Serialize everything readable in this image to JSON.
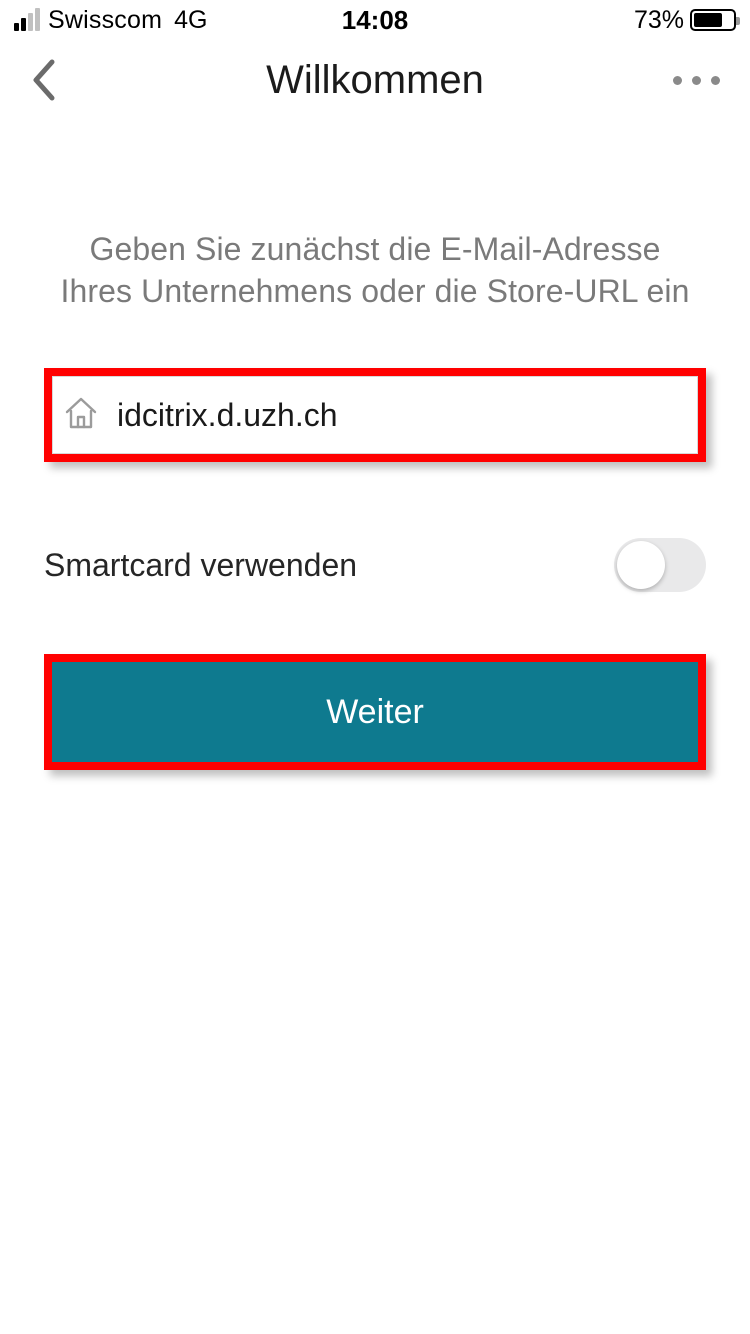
{
  "status": {
    "carrier": "Swisscom",
    "network": "4G",
    "time": "14:08",
    "battery_pct": "73%",
    "battery_fill_pct": 73,
    "signal_bars_on": 2,
    "signal_bars_total": 4
  },
  "nav": {
    "title": "Willkommen"
  },
  "instruction": "Geben Sie zunächst die E-Mail-Adresse Ihres Unternehmens oder die Store-URL ein",
  "input": {
    "value": "idcitrix.d.uzh.ch"
  },
  "smartcard": {
    "label": "Smartcard verwenden",
    "on": false
  },
  "button": {
    "label": "Weiter"
  },
  "colors": {
    "highlight": "#ff0000",
    "primary": "#0e7a8f"
  }
}
